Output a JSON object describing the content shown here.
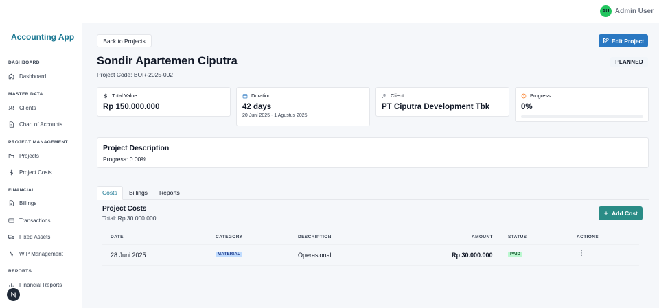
{
  "app": {
    "name": "Accounting App"
  },
  "user": {
    "initials": "AU",
    "name": "Admin User"
  },
  "sidebar": {
    "sections": [
      {
        "title": "DASHBOARD",
        "items": [
          {
            "label": "Dashboard",
            "icon": "home-icon"
          }
        ]
      },
      {
        "title": "MASTER DATA",
        "items": [
          {
            "label": "Clients",
            "icon": "users-icon"
          },
          {
            "label": "Chart of Accounts",
            "icon": "file-icon"
          }
        ]
      },
      {
        "title": "PROJECT MANAGEMENT",
        "items": [
          {
            "label": "Projects",
            "icon": "folder-icon"
          },
          {
            "label": "Project Costs",
            "icon": "dollar-icon"
          }
        ]
      },
      {
        "title": "FINANCIAL",
        "items": [
          {
            "label": "Billings",
            "icon": "file-icon"
          },
          {
            "label": "Transactions",
            "icon": "card-icon"
          },
          {
            "label": "Fixed Assets",
            "icon": "truck-icon"
          },
          {
            "label": "WIP Management",
            "icon": "activity-icon"
          }
        ]
      },
      {
        "title": "REPORTS",
        "items": [
          {
            "label": "Financial Reports",
            "icon": "bar-chart-icon"
          }
        ]
      }
    ]
  },
  "header": {
    "back_label": "Back to Projects",
    "edit_label": "Edit Project",
    "title": "Sondir Apartemen Ciputra",
    "code": "Project Code: BOR-2025-002",
    "status": "PLANNED"
  },
  "cards": {
    "value": {
      "label": "Total Value",
      "value": "Rp 150.000.000",
      "icon": "dollar-icon"
    },
    "duration": {
      "label": "Duration",
      "value": "42 days",
      "sub": "20 Juni 2025 - 1 Agustus 2025",
      "icon": "calendar-icon"
    },
    "client": {
      "label": "Client",
      "value": "PT Ciputra Development Tbk",
      "icon": "user-icon"
    },
    "progress": {
      "label": "Progress",
      "value": "0%",
      "fraction": 0,
      "icon": "clock-icon"
    }
  },
  "description": {
    "title": "Project Description",
    "text": "Progress: 0.00%"
  },
  "tabs": [
    {
      "label": "Costs"
    },
    {
      "label": "Billings"
    },
    {
      "label": "Reports"
    }
  ],
  "costs": {
    "title": "Project Costs",
    "total": "Total: Rp 30.000.000",
    "add_label": "Add Cost",
    "columns": {
      "date": "DATE",
      "category": "CATEGORY",
      "description": "DESCRIPTION",
      "amount": "AMOUNT",
      "status": "STATUS",
      "actions": "ACTIONS"
    },
    "rows": [
      {
        "date": "28 Juni 2025",
        "category": "MATERIAL",
        "description": "Operasional",
        "amount": "Rp 30.000.000",
        "status": "PAID",
        "actions_icon": "more-vertical-icon"
      }
    ]
  },
  "colors": {
    "brand": "#1f7a94",
    "primary": "#2a78c2",
    "teal": "#2a8c86",
    "avatar": "#22c55e"
  }
}
